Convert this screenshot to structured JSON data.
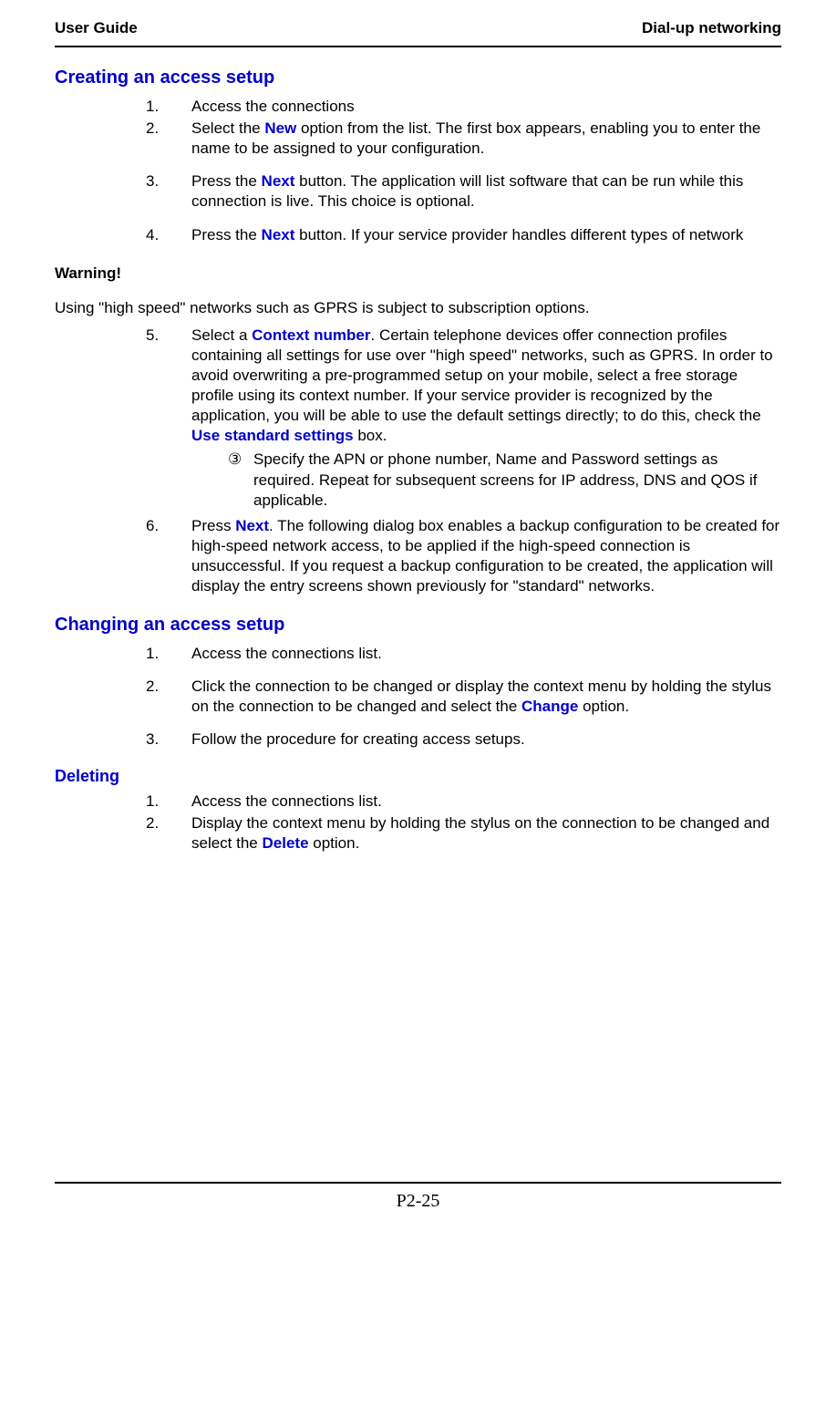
{
  "header": {
    "left": "User Guide",
    "right": "Dial-up networking"
  },
  "s1": {
    "heading": "Creating an access setup",
    "i1_num": "1.",
    "i1_text": "Access the connections",
    "i2_num": "2.",
    "i2_a": "Select the ",
    "i2_b": "New",
    "i2_c": " option from the list. The first box appears, enabling you to enter the name to be assigned to your configuration.",
    "i3_num": "3.",
    "i3_a": "Press the ",
    "i3_b": "Next",
    "i3_c": " button. The application will list software that can be run while this connection is live. This choice is optional.",
    "i4_num": "4.",
    "i4_a": "Press the ",
    "i4_b": "Next",
    "i4_c": " button. If your service provider handles different types of network"
  },
  "warn": {
    "heading": "Warning!",
    "text": "Using \"high speed\" networks such as GPRS is subject to subscription options."
  },
  "s1b": {
    "i5_num": "5.",
    "i5_a": "Select a ",
    "i5_b": "Context number",
    "i5_c": ". Certain telephone devices offer connection profiles containing all settings for use over \"high speed\" networks, such as GPRS. In order to avoid overwriting a pre-programmed setup on your mobile, select a free storage profile using its context number. If your service provider is recognized by the application, you will be able to use the default settings directly; to do this, check the ",
    "i5_d": "Use standard settings",
    "i5_e": " box.",
    "circ_marker": "③",
    "circ_text": "Specify the APN or phone number, Name and Password settings as required. Repeat for subsequent screens for IP address, DNS and QOS if applicable.",
    "i6_num": "6.",
    "i6_a": "Press ",
    "i6_b": "Next",
    "i6_c": ". The following dialog box enables a backup configuration to be created for high-speed network access, to be applied if the high-speed connection is unsuccessful. If you request a backup configuration to be created, the application will display the entry screens shown previously for \"standard\" networks."
  },
  "s2": {
    "heading": "Changing an access setup",
    "i1_num": "1.",
    "i1_text": "Access the connections list.",
    "i2_num": "2.",
    "i2_a": "Click the connection to be changed or display the context menu by holding the stylus on the connection to be changed and select the ",
    "i2_b": "Change",
    "i2_c": " option.",
    "i3_num": "3.",
    "i3_text": "Follow the procedure for creating access setups."
  },
  "s3": {
    "heading": "Deleting",
    "i1_num": "1.",
    "i1_text": "Access the connections list.",
    "i2_num": "2.",
    "i2_a": "Display the context menu by holding the stylus on the connection to be changed and select the ",
    "i2_b": "Delete",
    "i2_c": " option."
  },
  "footer": {
    "page": "P2-25"
  }
}
